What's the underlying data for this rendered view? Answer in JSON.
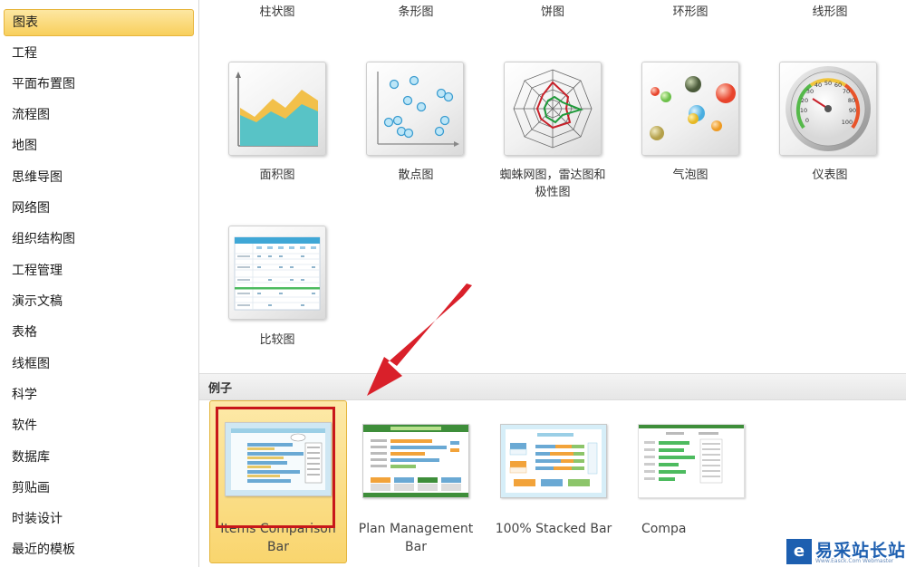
{
  "sidebar": {
    "items": [
      {
        "label": "图表",
        "selected": true
      },
      {
        "label": "工程"
      },
      {
        "label": "平面布置图"
      },
      {
        "label": "流程图"
      },
      {
        "label": "地图"
      },
      {
        "label": "思维导图"
      },
      {
        "label": "网络图"
      },
      {
        "label": "组织结构图"
      },
      {
        "label": "工程管理"
      },
      {
        "label": "演示文稿"
      },
      {
        "label": "表格"
      },
      {
        "label": "线框图"
      },
      {
        "label": "科学"
      },
      {
        "label": "软件"
      },
      {
        "label": "数据库"
      },
      {
        "label": "剪贴画"
      },
      {
        "label": "时装设计"
      },
      {
        "label": "最近的模板"
      }
    ]
  },
  "templates": {
    "top_row_labels": [
      "柱状图",
      "条形图",
      "饼图",
      "环形图",
      "线形图"
    ],
    "row2": [
      {
        "label": "面积图",
        "icon": "area-chart-icon"
      },
      {
        "label": "散点图",
        "icon": "scatter-chart-icon"
      },
      {
        "label_line1": "蜘蛛网图，雷达图和",
        "label_line2": "极性图",
        "icon": "radar-chart-icon"
      },
      {
        "label": "气泡图",
        "icon": "bubble-chart-icon"
      },
      {
        "label": "仪表图",
        "icon": "gauge-chart-icon"
      }
    ],
    "row3": [
      {
        "label": "比较图",
        "icon": "comparison-table-icon"
      }
    ]
  },
  "gauge_ticks": [
    "0",
    "10",
    "20",
    "30",
    "40",
    "50",
    "60",
    "70",
    "80",
    "90",
    "100"
  ],
  "examples": {
    "header": "例子",
    "items": [
      {
        "line1": "Items Comparison",
        "line2": "Bar",
        "selected": true
      },
      {
        "line1": "Plan Management",
        "line2": "Bar"
      },
      {
        "line1": "100% Stacked Bar",
        "line2": ""
      },
      {
        "line1": "Compa",
        "line2": ""
      }
    ]
  },
  "watermark": {
    "logo_glyph": "e",
    "name": "易采站长站",
    "sub": "Www.Easck.Com Webmaster"
  },
  "colors": {
    "selection": "#f8cf5c",
    "annotation_red": "#c8171a",
    "brand_blue": "#1d5fb0"
  }
}
